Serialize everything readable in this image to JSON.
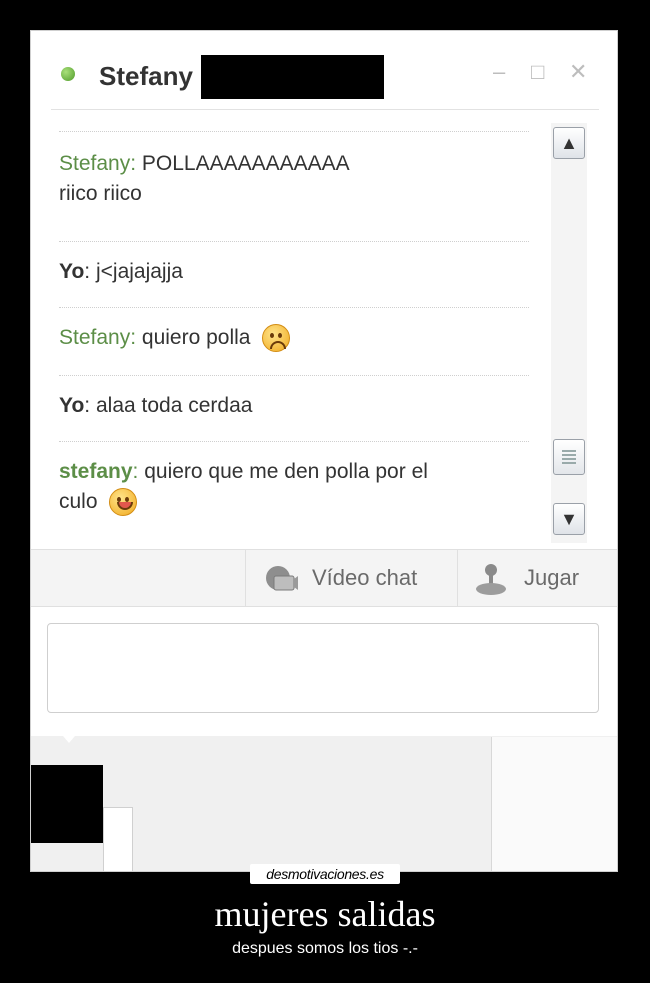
{
  "chat": {
    "contact_name": "Stefany",
    "window_controls": {
      "minimize": "–",
      "maximize": "□",
      "close": "✕"
    },
    "messages": [
      {
        "sender": "Stefany",
        "line1": "POLLAAAAAAAAAAA",
        "line2": "riico riico"
      },
      {
        "sender": "Yo",
        "text": "j<jajajajja"
      },
      {
        "sender": "Stefany",
        "text": "quiero polla",
        "emoji": "sad-face-icon"
      },
      {
        "sender": "Yo",
        "text": "alaa toda cerdaa"
      },
      {
        "sender": "stefany",
        "line1": "quiero que me den polla por el",
        "line2": "culo",
        "emoji": "tongue-face-icon"
      }
    ],
    "separator": ":",
    "toolbar": {
      "video_chat": "Vídeo chat",
      "play": "Jugar"
    },
    "composer_value": ""
  },
  "poster": {
    "watermark": "desmotivaciones.es",
    "title": "mujeres salidas",
    "subtitle": "despues somos los tios -.-"
  },
  "colors": {
    "online_status": "#5aa532",
    "sender_green": "#5c8e47",
    "background": "#000000"
  }
}
